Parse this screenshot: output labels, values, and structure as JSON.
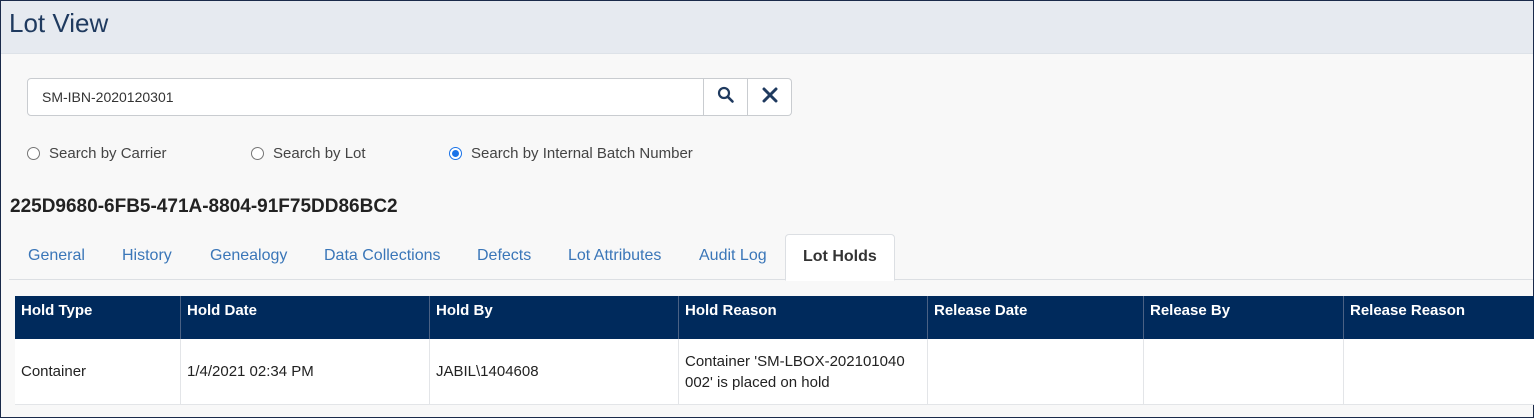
{
  "page": {
    "title": "Lot View"
  },
  "search": {
    "value": "SM-IBN-2020120301",
    "search_icon": "search-icon",
    "clear_icon": "close-icon"
  },
  "search_modes": [
    {
      "label": "Search by Carrier",
      "checked": false
    },
    {
      "label": "Search by Lot",
      "checked": false
    },
    {
      "label": "Search by Internal Batch Number",
      "checked": true
    }
  ],
  "lot": {
    "id": "225D9680-6FB5-471A-8804-91F75DD86BC2"
  },
  "tabs": [
    {
      "label": "General"
    },
    {
      "label": "History"
    },
    {
      "label": "Genealogy"
    },
    {
      "label": "Data Collections"
    },
    {
      "label": "Defects"
    },
    {
      "label": "Lot Attributes"
    },
    {
      "label": "Audit Log"
    },
    {
      "label": "Lot Holds",
      "active": true
    }
  ],
  "holds_table": {
    "columns": [
      "Hold Type",
      "Hold Date",
      "Hold By",
      "Hold Reason",
      "Release Date",
      "Release By",
      "Release Reason"
    ],
    "rows": [
      [
        "Container",
        "1/4/2021 02:34 PM",
        "JABIL\\1404608",
        "Container 'SM-LBOX-202101040 002' is placed on hold",
        "",
        "",
        ""
      ]
    ]
  },
  "colors": {
    "header_bg": "#e6eaf0",
    "grid_header_bg": "#002a5c",
    "tab_link": "#3a76b8",
    "radio_accent": "#1a73e8"
  }
}
